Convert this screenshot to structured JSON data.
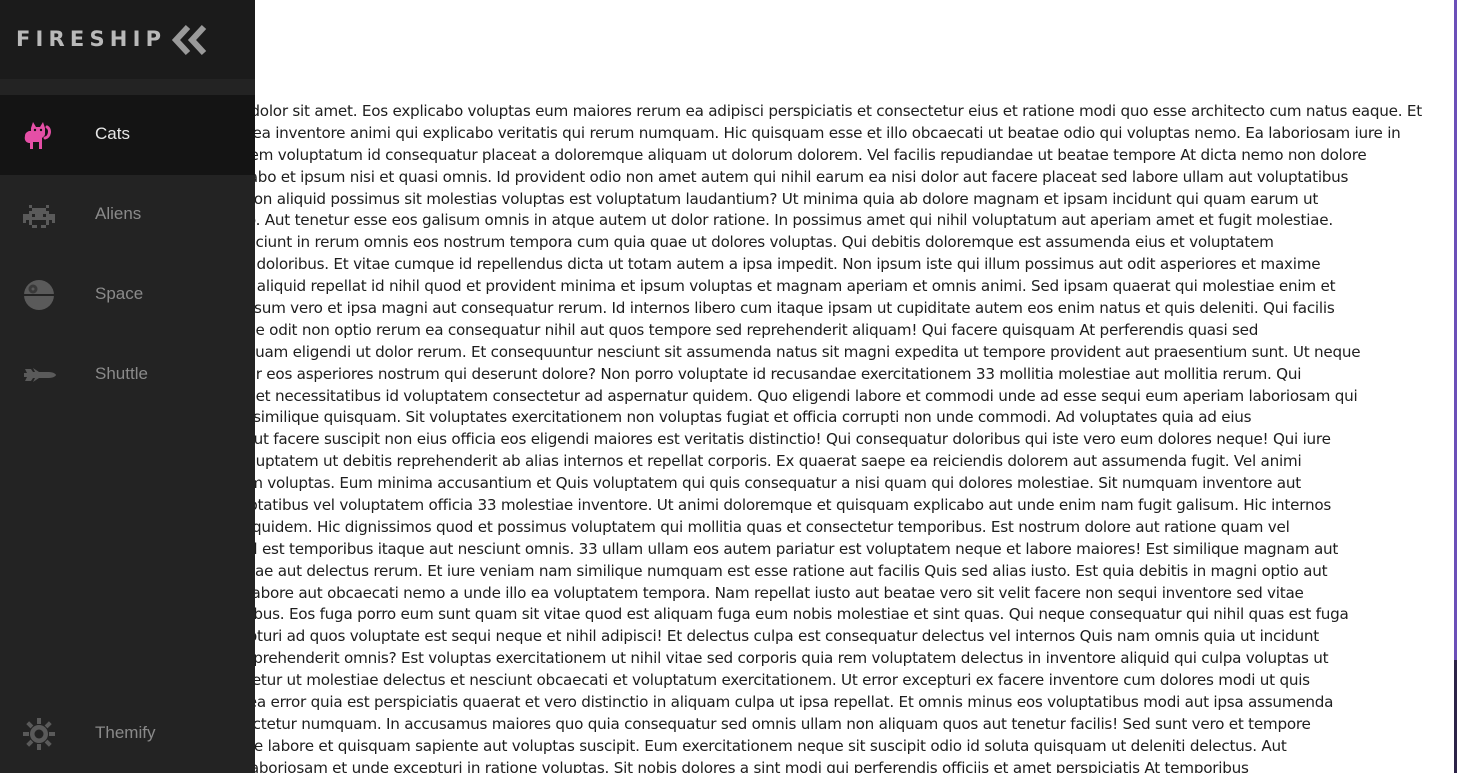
{
  "sidebar": {
    "logo": "FIRESHIP",
    "collapse_icon": "double-chevron-left-icon",
    "items": [
      {
        "label": "Cats",
        "icon": "cat-icon",
        "active": true
      },
      {
        "label": "Aliens",
        "icon": "space-invader-icon",
        "active": false
      },
      {
        "label": "Space",
        "icon": "death-star-icon",
        "active": false
      },
      {
        "label": "Shuttle",
        "icon": "space-shuttle-icon",
        "active": false
      }
    ],
    "footer_item": {
      "label": "Themify",
      "icon": "sun-icon"
    }
  },
  "colors": {
    "sidebar_bg": "#232323",
    "brand_bg": "#1b1b1b",
    "active_bg": "#141414",
    "accent": "#e54fa6",
    "icon_muted": "#5a5a5a",
    "scrollbar": "#6b4fb8"
  },
  "article": {
    "lines": [
      "Lorem ipsum dolor sit amet. Eos explicabo voluptas eum maiores rerum ea adipisci perspiciatis et consectetur eius et ratione modi quo esse architecto cum natus eaque. Et",
      "dolores quasi ea inventore animi qui explicabo veritatis qui rerum numquam. Hic quisquam esse et illo obcaecati ut beatae odio qui voluptas nemo. Ea laboriosam iure in",
      "tempora quidem voluptatum id consequatur placeat a doloremque aliquam ut dolorum dolorem. Vel facilis repudiandae ut beatae tempore At dicta nemo non dolore",
      "quia et explicabo et ipsum nisi et quasi omnis. Id provident odio non amet autem qui nihil earum ea nisi dolor aut facere placeat sed labore ullam aut voluptatibus",
      "et provident non aliquid possimus sit molestias voluptas est voluptatum laudantium? Ut minima quia ab dolore magnam et ipsam incidunt qui quam earum ut",
      "odit quod odio. Aut tenetur esse eos galisum omnis in atque autem ut dolor ratione. In possimus amet qui nihil voluptatum aut aperiam amet et fugit molestiae.",
      "Ipsum nisi nesciunt in rerum omnis eos nostrum tempora cum quia quae ut dolores voluptas. Qui debitis doloremque est assumenda eius et voluptatem",
      "consequuntur doloribus. Et vitae cumque id repellendus dicta ut totam autem a ipsa impedit. Non ipsum iste qui illum possimus aut odit asperiores et maxime",
      "optio quia aut aliquid repellat id nihil quod et provident minima et ipsum voluptas et magnam aperiam et omnis animi. Sed ipsam quaerat qui molestiae enim et",
      "quos eum galisum vero et ipsa magni aut consequatur rerum. Id internos libero cum itaque ipsam ut cupiditate autem eos enim natus et quis deleniti. Qui facilis",
      "aut recusandae odit non optio rerum ea consequatur nihil aut quos tempore sed reprehenderit aliquam! Qui facere quisquam At perferendis quasi sed",
      "dolorem quisquam eligendi ut dolor rerum. Et consequuntur nesciunt sit assumenda natus sit magni expedita ut tempore provident aut praesentium sunt. Ut neque",
      "sint aspernatur eos asperiores nostrum qui deserunt dolore? Non porro voluptate id recusandae exercitationem 33 mollitia molestiae aut mollitia rerum. Qui",
      "dolorem eveniet necessitatibus id voluptatem consectetur ad aspernatur quidem. Quo eligendi labore et commodi unde ad esse sequi eum aperiam laboriosam qui",
      "vero nihil sed similique quisquam. Sit voluptates exercitationem non voluptas fugiat et officia corrupti non unde commodi. Ad voluptates quia ad eius",
      "corrupti iure aut facere suscipit non eius officia eos eligendi maiores est veritatis distinctio! Qui consequatur doloribus qui iste vero eum dolores neque! Qui iure",
      "et veritatis voluptatem ut debitis reprehenderit ab alias internos et repellat corporis. Ex quaerat saepe ea reiciendis dolorem aut assumenda fugit. Vel animi",
      "eum et quidem voluptas. Eum minima accusantium et Quis voluptatem qui quis consequatur a nisi quam qui dolores molestiae. Sit numquam inventore aut",
      "ducimus voluptatibus vel voluptatem officia 33 molestiae inventore. Ut animi doloremque et quisquam explicabo aut unde enim nam fugit galisum. Hic internos",
      "iusto est ipsa quidem. Hic dignissimos quod et possimus voluptatem qui mollitia quas et consectetur temporibus. Est nostrum dolore aut ratione quam vel",
      "molestiae nihil est temporibus itaque aut nesciunt omnis. 33 ullam ullam eos autem pariatur est voluptatem neque et labore maiores! Est similique magnam aut",
      "minim molestiae aut delectus rerum. Et iure veniam nam similique numquam est esse ratione aut facilis Quis sed alias iusto. Est quia debitis in magni optio aut",
      "est similique labore aut obcaecati nemo a unde illo ea voluptatem tempora. Nam repellat iusto aut beatae vero sit velit facere non sequi inventore sed vitae",
      "nobis di doloribus. Eos fuga porro eum sunt quam sit vitae quod est aliquam fuga eum nobis molestiae et sint quas. Qui neque consequatur qui nihil quas est fuga",
      "pariatur excepturi ad quos voluptate est sequi neque et nihil adipisci! Et delectus culpa est consequatur delectus vel internos Quis nam omnis quia ut incidunt",
      "ut unde est reprehenderit omnis? Est voluptas exercitationem ut nihil vitae sed corporis quia rem voluptatem delectus in inventore aliquid qui culpa voluptas ut",
      "eum quos tenetur ut molestiae delectus et nesciunt obcaecati et voluptatum exercitationem. Ut error excepturi ex facere inventore cum dolores modi ut quis",
      "et architecto ea error quia est perspiciatis quaerat et vero distinctio in aliquam culpa ut ipsa repellat. Et omnis minus eos voluptatibus modi aut ipsa assumenda",
      "non est consectetur numquam. In accusamus maiores quo quia consequatur sed omnis ullam non aliquam quos aut tenetur facilis! Sed sunt vero et tempore",
      "dolore id saepe labore et quisquam sapiente aut voluptas suscipit. Eum exercitationem neque sit suscipit odio id soluta quisquam ut deleniti delectus. Aut",
      "ut qui officia laboriosam et unde excepturi in ratione voluptas. Sit nobis dolores a sint modi qui perferendis officiis et amet perspiciatis At temporibus"
    ]
  }
}
